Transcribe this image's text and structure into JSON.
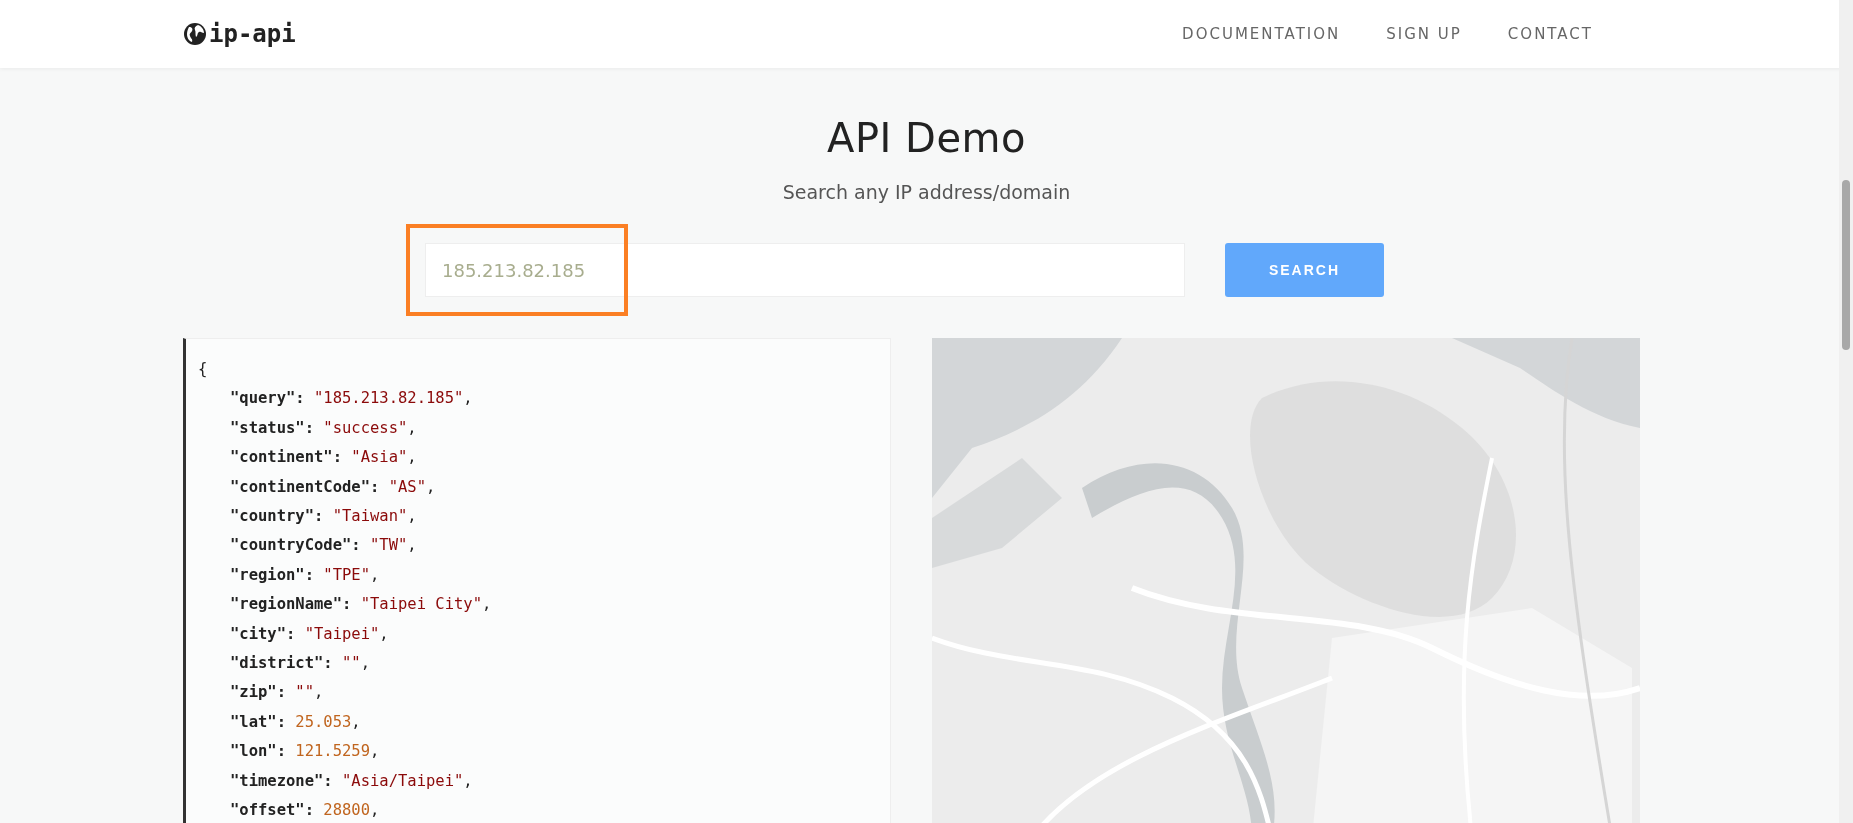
{
  "header": {
    "logo": "ip-api",
    "nav": [
      {
        "label": "DOCUMENTATION"
      },
      {
        "label": "SIGN UP"
      },
      {
        "label": "CONTACT"
      }
    ]
  },
  "demo": {
    "title": "API Demo",
    "subtitle": "Search any IP address/domain",
    "search": {
      "value": "185.213.82.185",
      "highlighted": true
    },
    "button": "SEARCH"
  },
  "response": {
    "open": "{",
    "lines": [
      {
        "key": "\"query\":",
        "value": "\"185.213.82.185\"",
        "trail": ",",
        "kind": "string"
      },
      {
        "key": "\"status\":",
        "value": "\"success\"",
        "trail": ",",
        "kind": "string"
      },
      {
        "key": "\"continent\":",
        "value": "\"Asia\"",
        "trail": ",",
        "kind": "string"
      },
      {
        "key": "\"continentCode\":",
        "value": "\"AS\"",
        "trail": ",",
        "kind": "string"
      },
      {
        "key": "\"country\":",
        "value": "\"Taiwan\"",
        "trail": ",",
        "kind": "string"
      },
      {
        "key": "\"countryCode\":",
        "value": "\"TW\"",
        "trail": ",",
        "kind": "string"
      },
      {
        "key": "\"region\":",
        "value": "\"TPE\"",
        "trail": ",",
        "kind": "string"
      },
      {
        "key": "\"regionName\":",
        "value": "\"Taipei City\"",
        "trail": ",",
        "kind": "string"
      },
      {
        "key": "\"city\":",
        "value": "\"Taipei\"",
        "trail": ",",
        "kind": "string"
      },
      {
        "key": "\"district\":",
        "value": "\"\"",
        "trail": ",",
        "kind": "string"
      },
      {
        "key": "\"zip\":",
        "value": "\"\"",
        "trail": ",",
        "kind": "string"
      },
      {
        "key": "\"lat\":",
        "value": "25.053",
        "trail": ",",
        "kind": "number"
      },
      {
        "key": "\"lon\":",
        "value": "121.5259",
        "trail": ",",
        "kind": "number"
      },
      {
        "key": "\"timezone\":",
        "value": "\"Asia/Taipei\"",
        "trail": ",",
        "kind": "string"
      },
      {
        "key": "\"offset\":",
        "value": "28800",
        "trail": ",",
        "kind": "number"
      }
    ]
  }
}
